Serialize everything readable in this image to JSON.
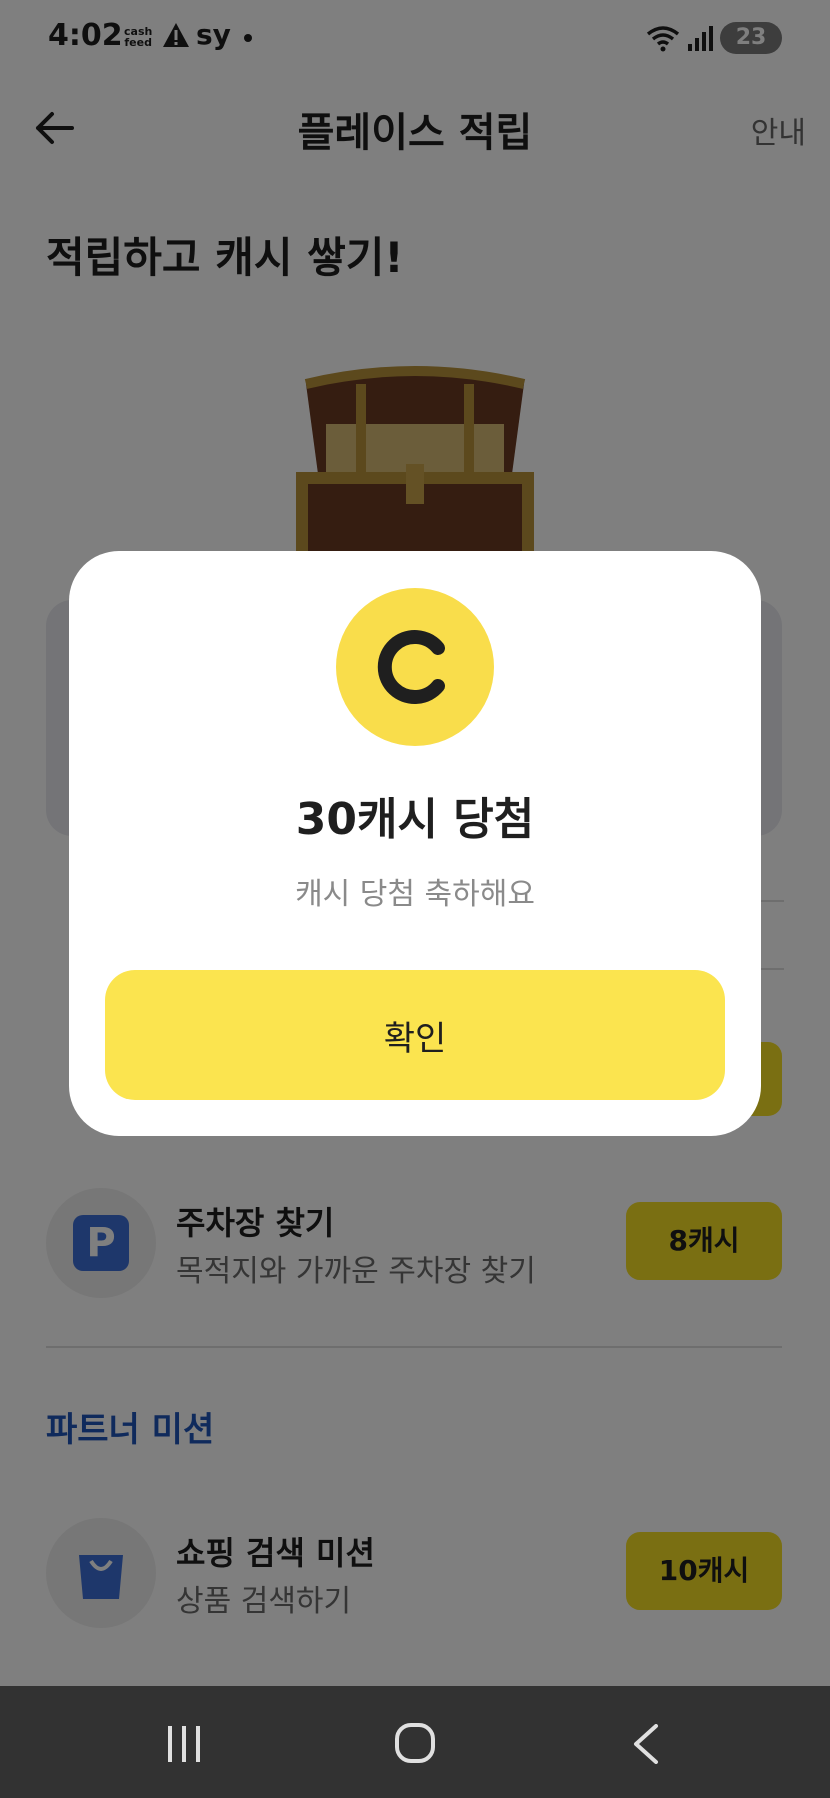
{
  "status_bar": {
    "time": "4:02",
    "cashfeed_line1": "cash",
    "cashfeed_line2": "feed",
    "carrier": "sy",
    "battery": "23"
  },
  "header": {
    "title": "플레이스 적립",
    "info_label": "안내",
    "back_icon": "arrow-left-icon"
  },
  "hero": {
    "title": "적립하고 캐시 쌓기!",
    "image": "treasure-chest"
  },
  "missions": [
    {
      "title": "주차장 찾기",
      "subtitle": "목적지와 가까운 주차장 찾기",
      "reward": "8캐시",
      "icon": "parking-icon",
      "icon_label": "P"
    }
  ],
  "partner_section": {
    "title": "파트너 미션",
    "items": [
      {
        "title": "쇼핑 검색 미션",
        "subtitle": "상품 검색하기",
        "reward": "10캐시",
        "icon": "shopping-bag-icon"
      }
    ]
  },
  "modal": {
    "coin_icon": "cash-coin-icon",
    "title": "30캐시 당첨",
    "subtitle": "캐시 당첨 축하해요",
    "confirm_label": "확인"
  },
  "colors": {
    "accent_yellow": "#fbe44f",
    "coin_yellow": "#f9dd4b",
    "section_blue": "#1f54b8",
    "parking_blue": "#3d6fd6"
  }
}
